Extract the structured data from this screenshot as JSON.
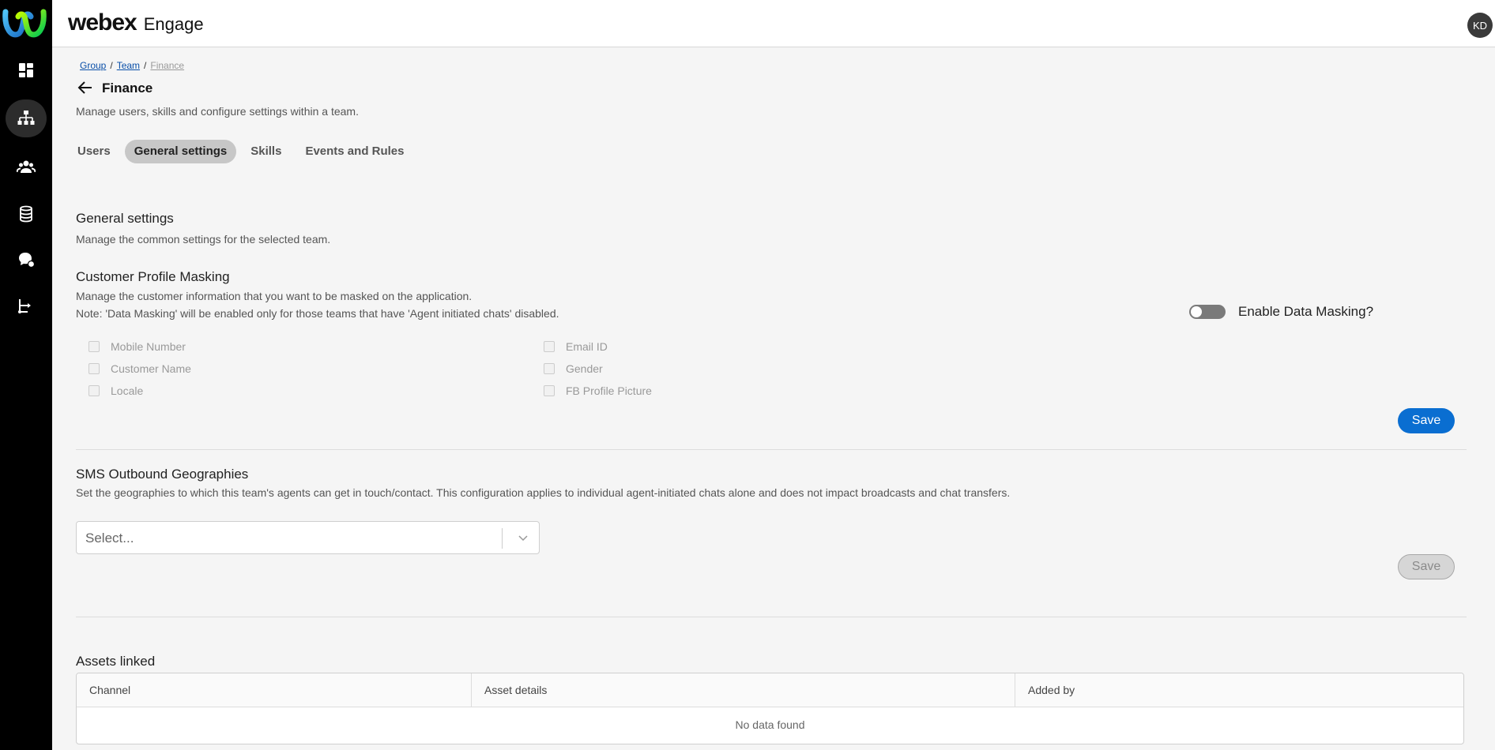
{
  "header": {
    "brand_main": "webex",
    "brand_sub": "Engage",
    "avatar_initials": "KD"
  },
  "sidebar": {
    "items": [
      "dashboard-icon",
      "org-hierarchy-icon",
      "users-group-icon",
      "database-icon",
      "chat-bubbles-icon",
      "integrations-icon"
    ],
    "active_index": 1
  },
  "breadcrumb": {
    "group": "Group",
    "team": "Team",
    "current": "Finance",
    "separator": "/"
  },
  "page": {
    "title": "Finance",
    "description": "Manage users, skills and configure settings within a team."
  },
  "tabs": [
    {
      "label": "Users",
      "active": false
    },
    {
      "label": "General settings",
      "active": true
    },
    {
      "label": "Skills",
      "active": false
    },
    {
      "label": "Events and Rules",
      "active": false
    }
  ],
  "general": {
    "title": "General settings",
    "description": "Manage the common settings for the selected team."
  },
  "masking": {
    "title": "Customer Profile Masking",
    "description": "Manage the customer information that you want to be masked on the application.",
    "note": "Note: 'Data Masking' will be enabled only for those teams that have 'Agent initiated chats' disabled.",
    "toggle_label": "Enable Data Masking?",
    "toggle_on": false,
    "fields": [
      "Mobile Number",
      "Email ID",
      "Customer Name",
      "Gender",
      "Locale",
      "FB Profile Picture"
    ],
    "save_label": "Save"
  },
  "sms": {
    "title": "SMS Outbound Geographies",
    "description": "Set the geographies to which this team's agents can get in touch/contact. This configuration applies to individual agent-initiated chats alone and does not impact broadcasts and chat transfers.",
    "select_placeholder": "Select...",
    "save_label": "Save"
  },
  "assets": {
    "title": "Assets linked",
    "columns": [
      "Channel",
      "Asset details",
      "Added by"
    ],
    "empty_text": "No data found"
  },
  "colors": {
    "primary": "#0a6ed1",
    "rail": "#000000",
    "background": "#f5f5f5"
  }
}
